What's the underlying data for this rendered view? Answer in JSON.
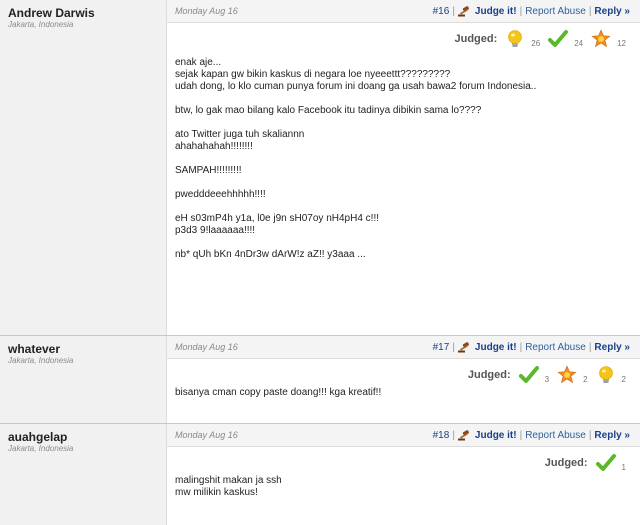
{
  "comments": [
    {
      "author": "Andrew Darwis",
      "location": "Jakarta, Indonesia",
      "date": "Monday Aug 16",
      "number": "#16",
      "judge_label": "Judge it!",
      "report_label": "Report Abuse",
      "reply_label": "Reply »",
      "judged_label": "Judged:",
      "judgements": [
        {
          "icon": "lightbulb-icon",
          "count": "26"
        },
        {
          "icon": "checkmark-icon",
          "count": "24"
        },
        {
          "icon": "star-icon",
          "count": "12"
        }
      ],
      "body": "enak aje...\nsejak kapan gw bikin kaskus di negara loe nyeeettt?????????\nudah dong, lo klo cuman punya forum ini doang ga usah bawa2 forum Indonesia..\n\nbtw, lo gak mao bilang kalo Facebook itu tadinya dibikin sama lo????\n\nato Twitter juga tuh skaliannn\nahahahahah!!!!!!!!\n\nSAMPAH!!!!!!!!!\n\npwedddeeehhhhh!!!!\n\neH s03mP4h y1a, l0e j9n sH07oy nH4pH4 c!!!\np3d3 9!laaaaaa!!!!\n\nnb* qUh bKn 4nDr3w dArW!z aZ!! y3aaa ..."
    },
    {
      "author": "whatever",
      "location": "Jakarta, Indonesia",
      "date": "Monday Aug 16",
      "number": "#17",
      "judge_label": "Judge it!",
      "report_label": "Report Abuse",
      "reply_label": "Reply »",
      "judged_label": "Judged:",
      "judgements": [
        {
          "icon": "checkmark-icon",
          "count": "3"
        },
        {
          "icon": "star-icon",
          "count": "2"
        },
        {
          "icon": "lightbulb-icon",
          "count": "2"
        }
      ],
      "body": "bisanya cman copy paste doang!!! kga kreatif!!"
    },
    {
      "author": "auahgelap",
      "location": "Jakarta, Indonesia",
      "date": "Monday Aug 16",
      "number": "#18",
      "judge_label": "Judge it!",
      "report_label": "Report Abuse",
      "reply_label": "Reply »",
      "judged_label": "Judged:",
      "judgements": [
        {
          "icon": "checkmark-icon",
          "count": "1"
        }
      ],
      "body": "malingshit makan ja ssh\nmw milikin kaskus!"
    }
  ],
  "colors": {
    "link_blue": "#1a3f8a",
    "check_green": "#5bb82a",
    "bulb_yellow": "#f5c516",
    "star_orange": "#f28a1c"
  }
}
